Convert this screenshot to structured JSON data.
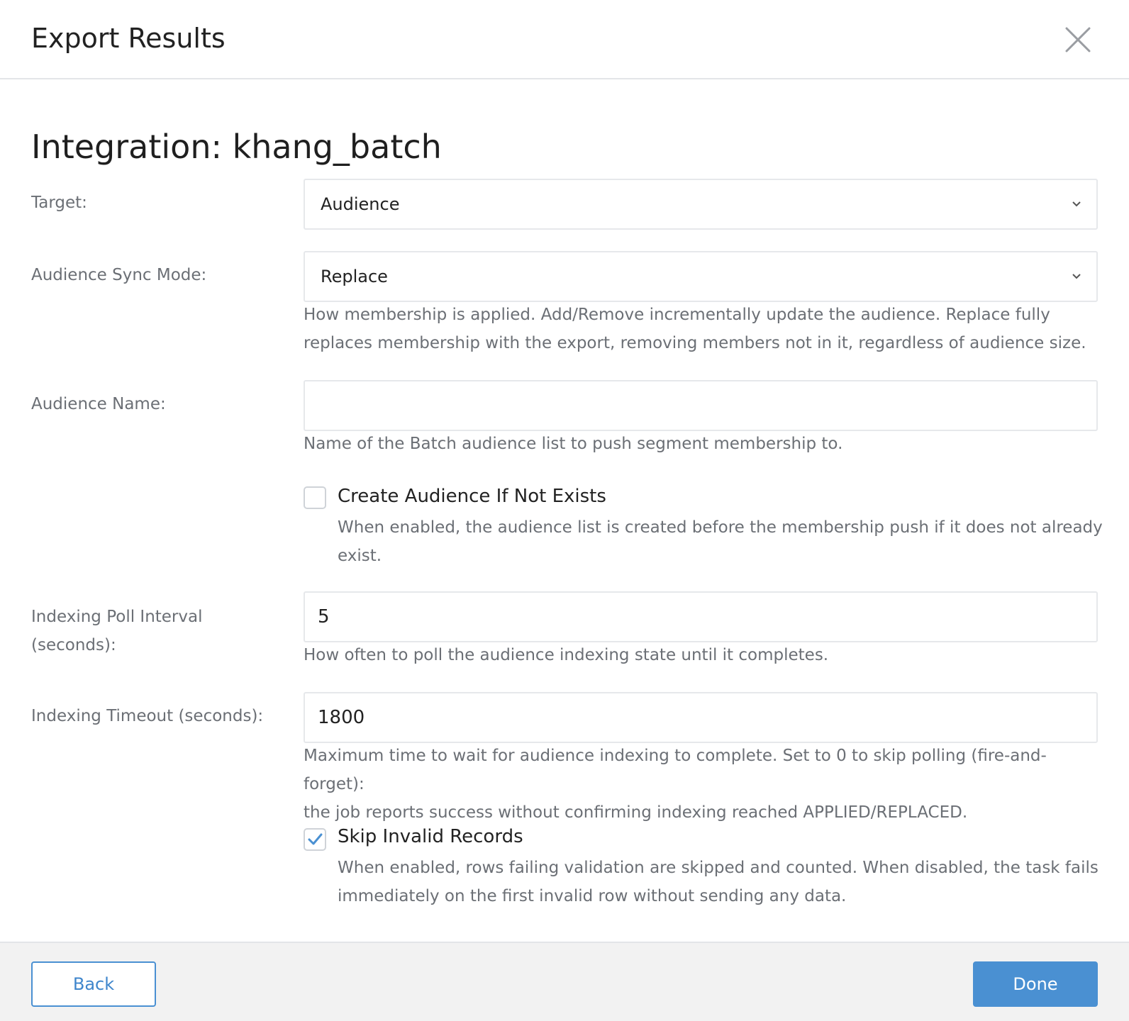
{
  "header": {
    "title": "Export Results"
  },
  "integration_title": "Integration: khang_batch",
  "fields": {
    "target": {
      "label": "Target:",
      "value": "Audience"
    },
    "sync_mode": {
      "label": "Audience Sync Mode:",
      "value": "Replace",
      "help_line1": "How membership is applied. Add/Remove incrementally update the audience. Replace fully",
      "help_line2": "replaces membership with the export, removing members not in it, regardless of audience size."
    },
    "audience_name": {
      "label": "Audience Name:",
      "value": "",
      "help": "Name of the Batch audience list to push segment membership to."
    },
    "create_audience": {
      "label": "Create Audience If Not Exists",
      "checked": false,
      "help_line1": "When enabled, the audience list is created before the membership push if it does not already",
      "help_line2": "exist."
    },
    "poll_interval": {
      "label_line1": "Indexing Poll Interval",
      "label_line2": "(seconds):",
      "value": "5",
      "help": "How often to poll the audience indexing state until it completes."
    },
    "timeout": {
      "label": "Indexing Timeout (seconds):",
      "value": "1800",
      "help_line1": "Maximum time to wait for audience indexing to complete. Set to 0 to skip polling (fire-and-forget):",
      "help_line2": "the job reports success without confirming indexing reached APPLIED/REPLACED."
    },
    "skip_invalid": {
      "label": "Skip Invalid Records",
      "checked": true,
      "help_line1": "When enabled, rows failing validation are skipped and counted. When disabled, the task fails",
      "help_line2": "immediately on the first invalid row without sending any data."
    }
  },
  "footer": {
    "back_label": "Back",
    "done_label": "Done"
  },
  "colors": {
    "accent": "#4a90d2",
    "muted_text": "#6b6f75",
    "footer_bg": "#f2f2f2"
  }
}
